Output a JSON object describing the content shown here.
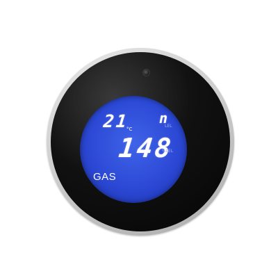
{
  "display": {
    "temperature_value": "21",
    "temperature_unit": "°C",
    "mode_indicator": "n",
    "unit_top": "LEL",
    "gas_reading": "148",
    "unit_bottom": "%LEL",
    "gas_label": "GAS"
  },
  "colors": {
    "lcd_background": "#2c49d6",
    "lcd_text": "#ffffff",
    "device_face": "#111111",
    "bezel": "#cfcfcf"
  }
}
